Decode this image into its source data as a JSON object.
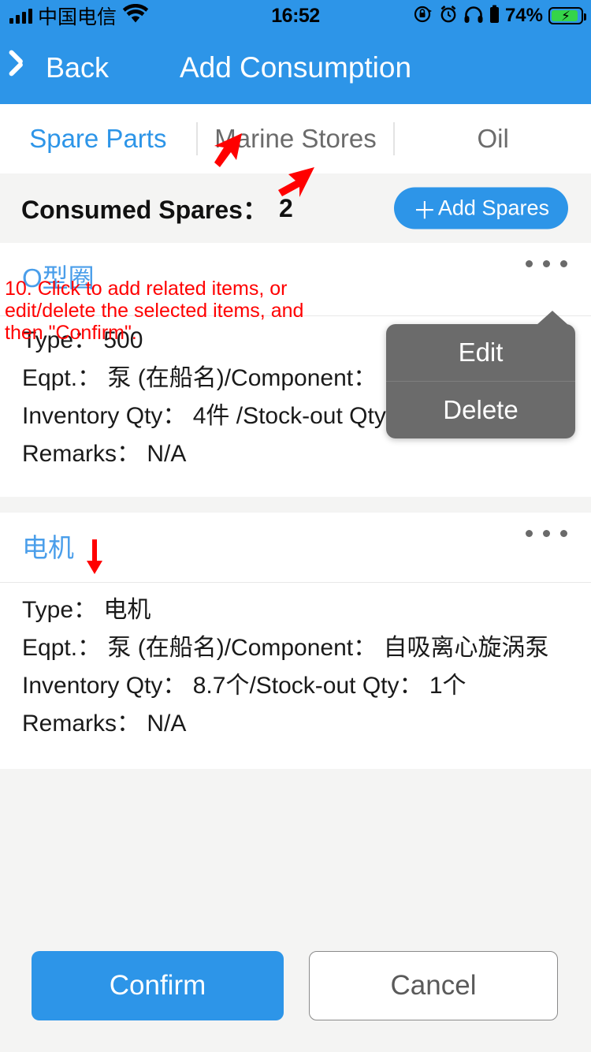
{
  "status_bar": {
    "carrier": "中国电信",
    "time": "16:52",
    "battery_percent": "74%",
    "icons": [
      "signal-bars-icon",
      "wifi-icon",
      "rotation-lock-icon",
      "alarm-icon",
      "headphones-icon",
      "headphone-battery-icon",
      "battery-charging-icon"
    ]
  },
  "nav": {
    "back_label": "Back",
    "title": "Add Consumption"
  },
  "tabs": [
    {
      "label": "Spare Parts",
      "active": true
    },
    {
      "label": "Marine Stores",
      "active": false
    },
    {
      "label": "Oil",
      "active": false
    }
  ],
  "section": {
    "title": "Consumed Spares：",
    "count": "2",
    "add_button": "Add Spares",
    "add_button_plus": "＋"
  },
  "cards": [
    {
      "title": "O型圈",
      "menu_icon": "more-options-icon",
      "rows": [
        "Type： 500",
        "Eqpt.： 泵 (在船名)/Component： 自吸离心旋涡泵",
        "Inventory Qty： 4件 /Stock-out Qty： 1件",
        "Remarks： N/A"
      ]
    },
    {
      "title": "电机",
      "menu_icon": "more-options-icon",
      "rows": [
        "Type： 电机",
        "Eqpt.： 泵 (在船名)/Component： 自吸离心旋涡泵",
        "Inventory Qty： 8.7个/Stock-out Qty： 1个",
        "Remarks： N/A"
      ]
    }
  ],
  "popup_menu": {
    "items": [
      "Edit",
      "Delete"
    ]
  },
  "footer": {
    "confirm": "Confirm",
    "cancel": "Cancel"
  },
  "annotation": {
    "text": "10. Click to add related items, or edit/delete the selected items, and then \"Confirm\".",
    "color": "#ff0000"
  },
  "colors": {
    "accent_blue": "#2d95e8",
    "tab_active": "#2d95e8",
    "card_title_blue": "#4a9eea",
    "section_bg": "#f4f4f3",
    "popup_bg": "#6b6b6b",
    "annotation_red": "#ff0000"
  }
}
